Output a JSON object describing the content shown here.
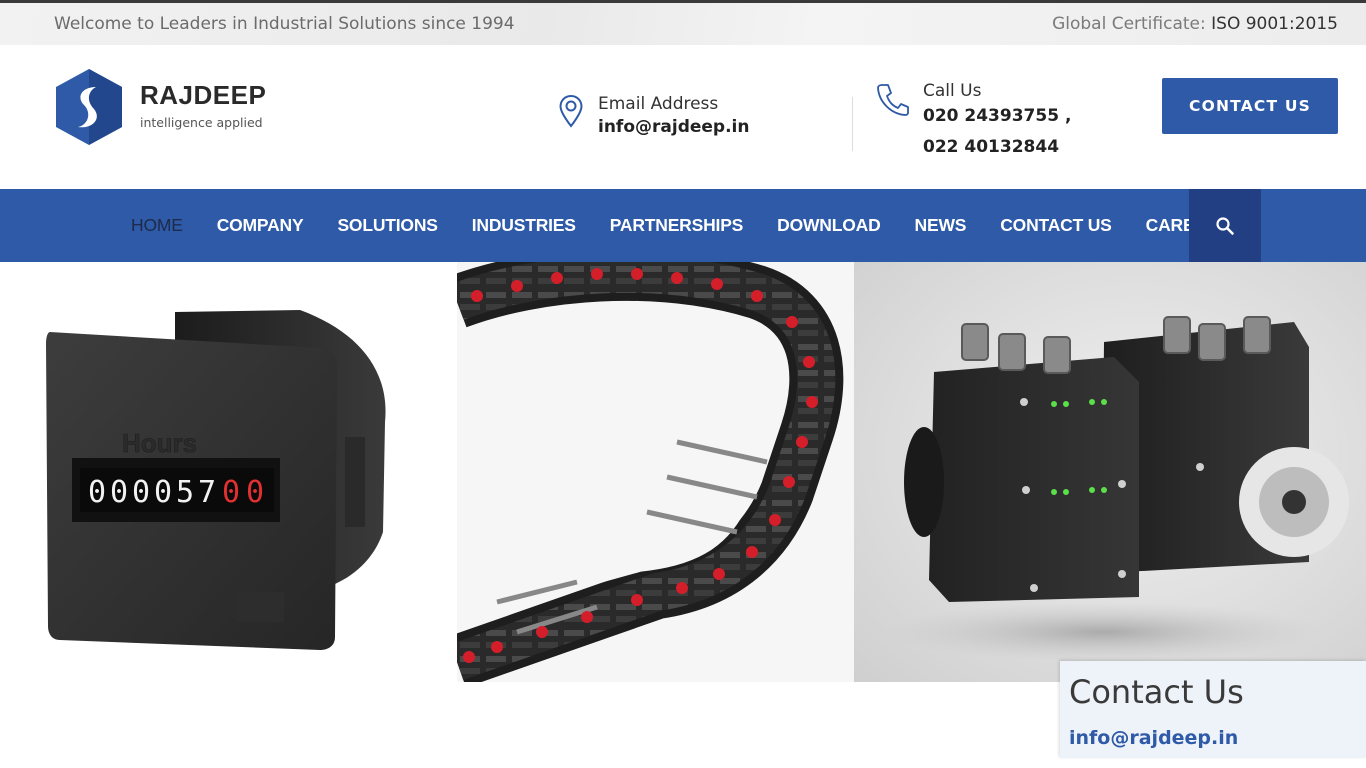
{
  "topbar": {
    "welcome": "Welcome to Leaders in Industrial Solutions since 1994",
    "cert_label": "Global Certificate:",
    "cert_value": "ISO 9001:2015"
  },
  "header": {
    "brand": "RAJDEEP",
    "tagline": "intelligence applied",
    "email_label": "Email Address",
    "email_value": "info@rajdeep.in",
    "call_label": "Call Us",
    "phone_1": "020 24393755 ,",
    "phone_2": "022 40132844",
    "contact_button": "CONTACT US"
  },
  "nav": {
    "items": [
      {
        "label": "HOME",
        "active": true
      },
      {
        "label": "COMPANY"
      },
      {
        "label": "SOLUTIONS"
      },
      {
        "label": "INDUSTRIES"
      },
      {
        "label": "PARTNERSHIPS"
      },
      {
        "label": "DOWNLOAD"
      },
      {
        "label": "NEWS"
      },
      {
        "label": "CONTACT US"
      },
      {
        "label": "CAREERS"
      }
    ],
    "search_icon": "search-icon"
  },
  "products": {
    "hour_counter_digits": "00005700"
  },
  "contact_widget": {
    "title": "Contact Us",
    "email": "info@rajdeep.in"
  },
  "colors": {
    "brand_blue": "#2e5aa8",
    "search_bg": "#223f84"
  }
}
